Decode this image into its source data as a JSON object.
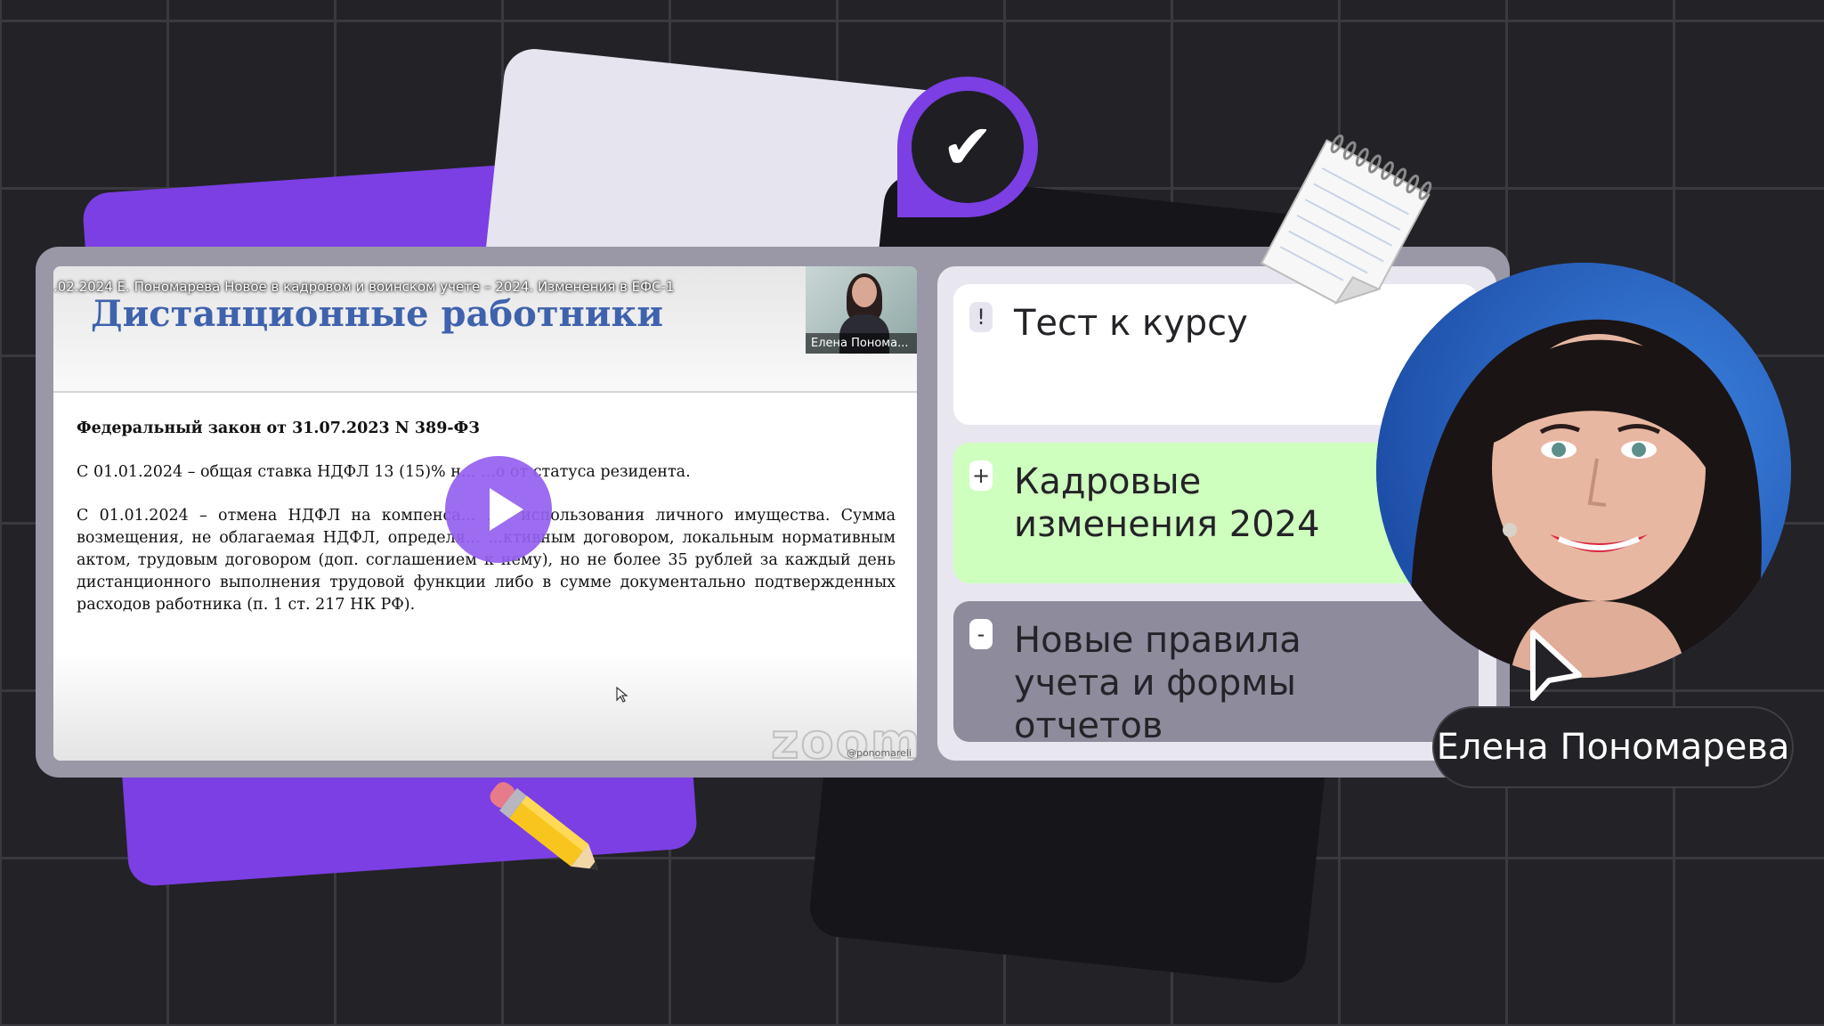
{
  "video": {
    "meeting_title": ".02.2024 Е. Пономарева Новое в кадровом и воинском учете – 2024. Изменения в ЕФС-1",
    "slide_title": "Дистанционные работники",
    "participant_name": "Елена Понома...",
    "law_heading": "Федеральный закон от 31.07.2023 N 389-ФЗ",
    "paragraph_1": "С 01.01.2024 – общая ставка НДФЛ 13 (15)% н...        ...о от статуса резидента.",
    "paragraph_2": "С 01.01.2024 – отмена НДФЛ на компенса...        ...з использования личного имущества. Сумма возмещения, не облагаемая НДФЛ, определя...     ...ктивным договором, локальным нормативным актом, трудовым договором (доп. соглашением к нему), но не более 35 рублей за каждый день дистанционного выполнения трудовой функции либо в сумме документально подтвержденных расходов работника (п. 1 ст. 217 НК РФ).",
    "watermark": "zoom",
    "watermark_user": "@ponomareli"
  },
  "course": {
    "items": [
      {
        "marker": "!",
        "label": "Тест к курсу"
      },
      {
        "marker": "+",
        "label": "Кадровые изменения 2024"
      },
      {
        "marker": "-",
        "label": "Новые правила учета и формы отчетов"
      }
    ]
  },
  "speaker": {
    "name": "Елена Пономарева"
  },
  "colors": {
    "accent": "#7b3fe4",
    "background": "#232226",
    "green": "#ceffbe",
    "photo_bg": "#2c64c9"
  },
  "icons": [
    "check-icon",
    "play-icon",
    "notepad-icon",
    "pencil-icon",
    "cursor-arrow-icon"
  ]
}
